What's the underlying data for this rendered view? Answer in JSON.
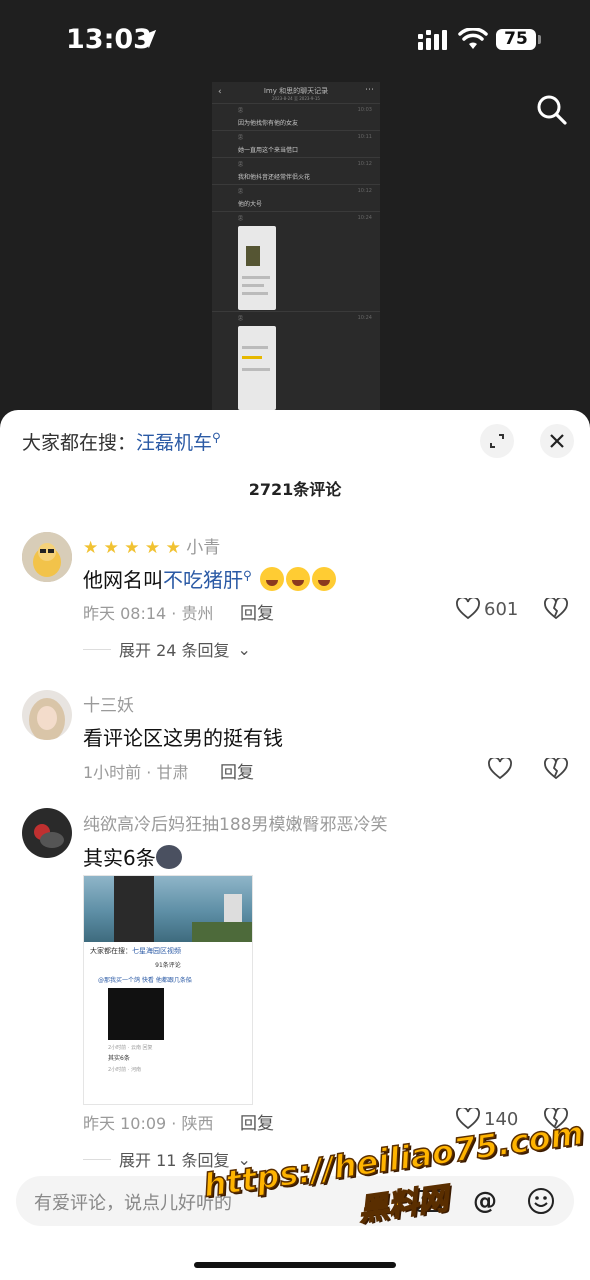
{
  "status_bar": {
    "time": "13:03",
    "battery": "75"
  },
  "video_preview": {
    "title": "Imy 和思的聊天记录",
    "subtitle": "2023-8-24 至 2023-9-15",
    "rows": [
      {
        "name": "思",
        "text": "因为他找你有他的女友",
        "time": "10:03"
      },
      {
        "name": "思",
        "text": "她一直用这个来当借口",
        "time": "10:11"
      },
      {
        "name": "思",
        "text": "我和他抖音还经常伴侣火花",
        "time": "10:12"
      },
      {
        "name": "思",
        "text": "他的大号",
        "time": "10:12"
      },
      {
        "name": "思",
        "text": "",
        "time": "10:24"
      },
      {
        "name": "思",
        "text": "",
        "time": "10:24"
      }
    ]
  },
  "sheet": {
    "hot_search_prefix": "大家都在搜：",
    "hot_search_keyword": "汪磊机车",
    "comment_count": "2721条评论"
  },
  "comments": [
    {
      "username": "小青",
      "text_prefix": "他网名叫",
      "text_keyword": "不吃猪肝",
      "meta": "昨天 08:14 · 贵州",
      "reply": "回复",
      "likes": "601",
      "expand": "展开 24 条回复"
    },
    {
      "username": "十三妖",
      "text": "看评论区这男的挺有钱",
      "meta": "1小时前 · 甘肃",
      "reply": "回复"
    },
    {
      "username": "纯欲高冷后妈狂抽188男模嫩臀邪恶冷笑",
      "text": "其实6条",
      "meta": "昨天 10:09 · 陕西",
      "reply": "回复",
      "likes": "140",
      "expand": "展开 11 条回复",
      "embed": {
        "hot_prefix": "大家都在搜：",
        "hot_keyword": "七星海园区视频",
        "count": "91条评论",
        "c1": "@那我买一个鸽 快看 他都跟几条船",
        "meta1": "2小时前 · 云南    回复",
        "c2": "其实6条",
        "meta2": "2小时前 · 河南"
      }
    }
  ],
  "input": {
    "placeholder": "有爱评论，说点儿好听的"
  },
  "watermark": {
    "url": "https://heiliao75.com",
    "name": "黑料网"
  }
}
